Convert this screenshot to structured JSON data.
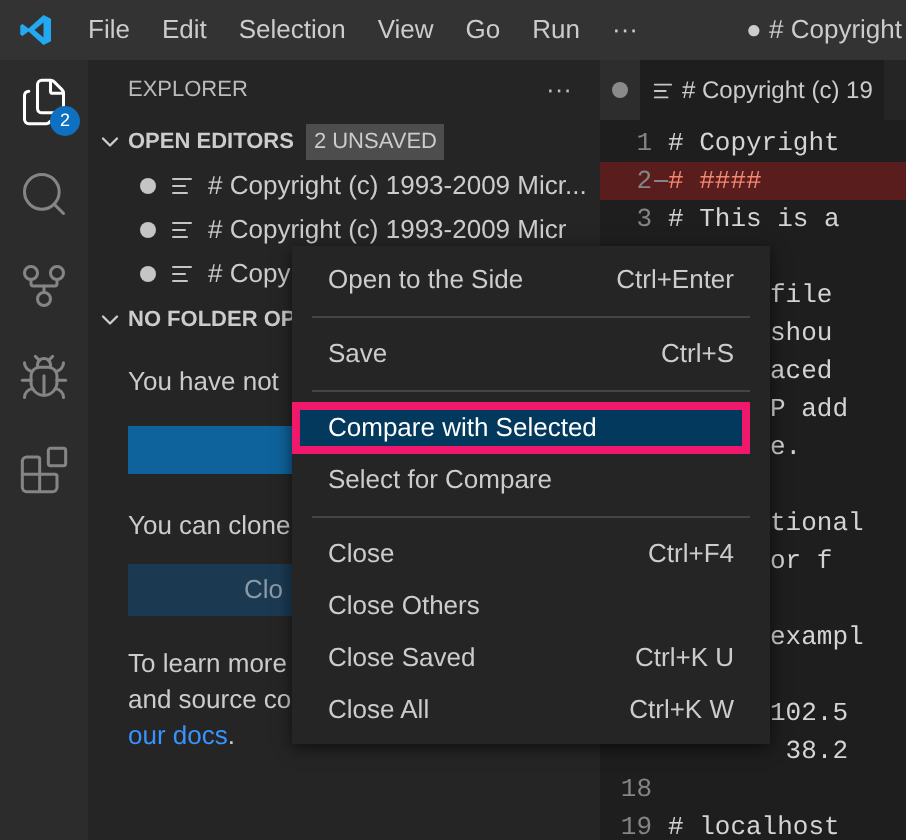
{
  "title_bar": {
    "menus": [
      "File",
      "Edit",
      "Selection",
      "View",
      "Go",
      "Run",
      "···"
    ],
    "title": "● # Copyright"
  },
  "activity_bar": {
    "items": [
      {
        "kind": "files",
        "selected": true,
        "badge": "2"
      },
      {
        "kind": "search",
        "selected": false
      },
      {
        "kind": "source-control",
        "selected": false
      },
      {
        "kind": "run",
        "selected": false
      },
      {
        "kind": "extensions",
        "selected": false
      }
    ]
  },
  "sidebar": {
    "title": "EXPLORER",
    "more": "···",
    "open_editors": {
      "title": "OPEN EDITORS",
      "badge": "2 UNSAVED",
      "expanded": true,
      "items": [
        {
          "label": "# Copyright (c) 1993-2009 Micr...",
          "dirty": true
        },
        {
          "label": "# Copyright (c) 1993-2009 Micr",
          "dirty": true
        },
        {
          "label": "# Copy",
          "dirty": true
        }
      ]
    },
    "no_folder": {
      "title": "NO FOLDER OP",
      "expanded": true,
      "text_1": "You have not",
      "text_2": "You can clone",
      "button_2": "Clo",
      "text_3": [
        "To learn more",
        "and source co"
      ],
      "link": "our docs",
      "link_suffix": "."
    }
  },
  "editor": {
    "tabs": [
      {
        "dirty": true,
        "selected": false
      },
      {
        "label": "# Copyright (c) 19",
        "dirty": false,
        "selected": true
      }
    ],
    "lines": [
      {
        "kind": "numbered",
        "number": "1",
        "text": "# Copyright",
        "deleted": false
      },
      {
        "kind": "numbered",
        "number": "2",
        "text": "# ####",
        "deleted": true
      },
      {
        "kind": "numbered",
        "number": "3",
        "text": "# This is a",
        "deleted": false
      },
      {
        "kind": "blank"
      },
      {
        "kind": "partial",
        "text": "file"
      },
      {
        "kind": "partial",
        "text": "shou"
      },
      {
        "kind": "partial",
        "text": "aced"
      },
      {
        "kind": "partial",
        "text": "P add"
      },
      {
        "kind": "partial",
        "text": "e."
      },
      {
        "kind": "blank"
      },
      {
        "kind": "partial",
        "text": "tional"
      },
      {
        "kind": "partial",
        "text": "or f"
      },
      {
        "kind": "blank"
      },
      {
        "kind": "partial",
        "text": "exampl"
      },
      {
        "kind": "blank"
      },
      {
        "kind": "partial",
        "text": "102.5"
      },
      {
        "kind": "partial",
        "text": " 38.2"
      },
      {
        "kind": "numbered",
        "number": "18",
        "deleted": false
      },
      {
        "kind": "numbered",
        "number": "19",
        "text": "# localhost",
        "deleted": false
      }
    ]
  },
  "context_menu": {
    "groups": [
      [
        {
          "label": "Open to the Side",
          "shortcut": "Ctrl+Enter",
          "selected": false
        }
      ],
      [
        {
          "label": "Save",
          "shortcut": "Ctrl+S",
          "selected": false
        }
      ],
      [
        {
          "label": "Compare with Selected",
          "selected": true,
          "highlighted": true
        },
        {
          "label": "Select for Compare",
          "selected": false
        }
      ],
      [
        {
          "label": "Close",
          "shortcut": "Ctrl+F4",
          "selected": false
        },
        {
          "label": "Close Others",
          "selected": false
        },
        {
          "label": "Close Saved",
          "shortcut": "Ctrl+K U",
          "selected": false
        },
        {
          "label": "Close All",
          "shortcut": "Ctrl+K W",
          "selected": false
        }
      ]
    ]
  }
}
